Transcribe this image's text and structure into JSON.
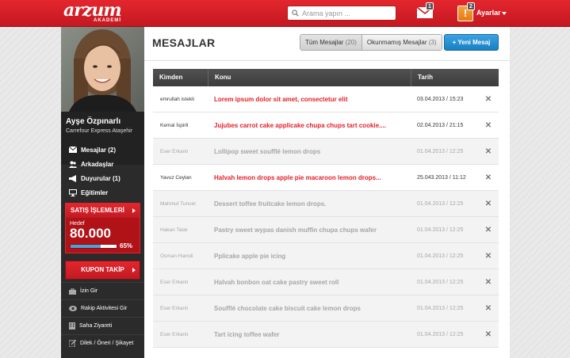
{
  "brand": {
    "name": "arzum",
    "sub": "AKADEMİ",
    "registered": "®"
  },
  "search": {
    "placeholder": "Arama yapın ..."
  },
  "header": {
    "mail_count": "1",
    "alert_count": "2",
    "alert_symbol": "!",
    "settings_label": "Ayarlar"
  },
  "colors": {
    "brand_red": "#d61f27",
    "accent_blue": "#2a8fd4",
    "unread_subject": "#e12029",
    "read_text": "#a6a6a6"
  },
  "profile": {
    "name": "Ayşe Özpınarlı",
    "subtitle": "Carrefour Express Ataşehir"
  },
  "nav": [
    {
      "label": "Mesajlar (2)",
      "icon": "mail-icon"
    },
    {
      "label": "Arkadaşlar",
      "icon": "users-icon"
    },
    {
      "label": "Duyurular (1)",
      "icon": "megaphone-icon"
    },
    {
      "label": "Eğitimler",
      "icon": "monitor-icon"
    }
  ],
  "sales": {
    "title": "SATIŞ İŞLEMLERİ",
    "target_label": "Hedef",
    "target_value": "80.000",
    "progress": 0.65,
    "progress_label": "65%"
  },
  "coupon": {
    "label": "KUPON TAKİP"
  },
  "nav2": [
    {
      "label": "İzin Gir",
      "icon": "briefcase-icon"
    },
    {
      "label": "Rakip Aktivitesi Gir",
      "icon": "eye-icon"
    },
    {
      "label": "Saha Ziyareti",
      "icon": "building-icon"
    },
    {
      "label": "Dilek / Öneri / Şikayet",
      "icon": "edit-icon"
    }
  ],
  "page": {
    "title": "MESAJLAR"
  },
  "filters": [
    {
      "label": "Tüm Mesajlar",
      "count": "(20)"
    },
    {
      "label": "Okunmamış  Mesajlar",
      "count": "(3)"
    }
  ],
  "new_message": {
    "plus": "+",
    "label": "Yeni Mesaj"
  },
  "table": {
    "headers": {
      "from": "Kimden",
      "subject": "Konu",
      "date": "Tarih"
    },
    "rows": [
      {
        "from": "emrullah istekli",
        "subject": "Lorem ipsum dolor sit amet, consectetur elit",
        "date": "03.04.2013 / 15:23",
        "read": false
      },
      {
        "from": "Kemal İspirli",
        "subject": "Jujubes carrot cake applicake chupa chups tart cookie....",
        "date": "02.04.2013 / 21:15",
        "read": false
      },
      {
        "from": "Eser Erkanlı",
        "subject": "Lollipop sweet soufflé lemon drops",
        "date": "01.04.2013 / 12:25",
        "read": true
      },
      {
        "from": "Yavuz Ceylan",
        "subject": "Halvah lemon drops apple pie macaroon lemon drops...",
        "date": "25.043.2013 / 11:12",
        "read": false
      },
      {
        "from": "Mahmut Tuncer",
        "subject": "Dessert toffee fruitcake lemon drops.",
        "date": "01.04.2013 / 12:25",
        "read": true
      },
      {
        "from": "Hakan Tatar",
        "subject": "Pastry sweet wypas danish muffin chupa chups wafer",
        "date": "01.04.2013 / 12:25",
        "read": true
      },
      {
        "from": "Osman Hamdi",
        "subject": "Pplicake apple pie icing",
        "date": "01.04.2013 / 12:25",
        "read": true
      },
      {
        "from": "Eser Erkanlı",
        "subject": "Halvah bonbon oat cake pastry sweet roll",
        "date": "01.04.2013 / 12:25",
        "read": true
      },
      {
        "from": "Eser Erkanlı",
        "subject": "Soufflé chocolate cake biscuit cake lemon drops",
        "date": "01.04.2013 / 12:25",
        "read": true
      },
      {
        "from": "Eser Erkanlı",
        "subject": "Tart icing toffee wafer",
        "date": "01.04.2013 / 12:25",
        "read": true
      }
    ],
    "delete_symbol": "✕"
  }
}
